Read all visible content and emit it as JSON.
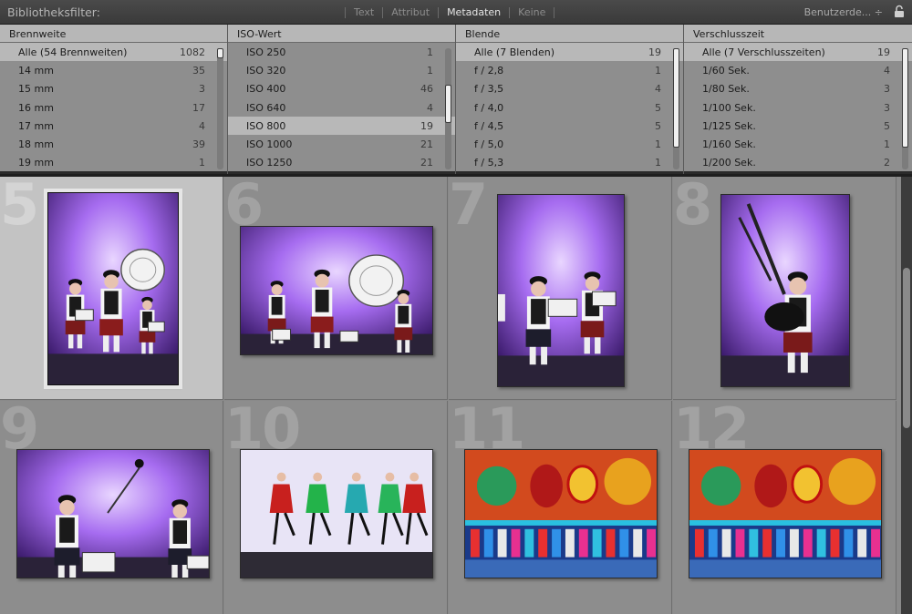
{
  "filterbar": {
    "title": "Bibliotheksfilter:",
    "modes": [
      {
        "label": "Text",
        "active": false
      },
      {
        "label": "Attribut",
        "active": false
      },
      {
        "label": "Metadaten",
        "active": true
      },
      {
        "label": "Keine",
        "active": false
      }
    ],
    "preset": "Benutzerde... ÷",
    "lock_icon": "lock-icon"
  },
  "columns": [
    {
      "header": "Brennweite",
      "rows": [
        {
          "label": "Alle (54 Brennweiten)",
          "count": "1082",
          "selected": true
        },
        {
          "label": "14 mm",
          "count": "35"
        },
        {
          "label": "15 mm",
          "count": "3"
        },
        {
          "label": "16 mm",
          "count": "17"
        },
        {
          "label": "17 mm",
          "count": "4"
        },
        {
          "label": "18 mm",
          "count": "39"
        },
        {
          "label": "19 mm",
          "count": "1"
        }
      ],
      "scroll_thumb": {
        "from": 0.0,
        "to": 0.08
      }
    },
    {
      "header": "ISO-Wert",
      "rows": [
        {
          "label": "ISO 250",
          "count": "1"
        },
        {
          "label": "ISO 320",
          "count": "1"
        },
        {
          "label": "ISO 400",
          "count": "46"
        },
        {
          "label": "ISO 640",
          "count": "4"
        },
        {
          "label": "ISO 800",
          "count": "19",
          "selected": true
        },
        {
          "label": "ISO 1000",
          "count": "21"
        },
        {
          "label": "ISO 1250",
          "count": "21"
        }
      ],
      "scroll_thumb": {
        "from": 0.3,
        "to": 0.62
      }
    },
    {
      "header": "Blende",
      "rows": [
        {
          "label": "Alle (7 Blenden)",
          "count": "19",
          "selected": true
        },
        {
          "label": "f / 2,8",
          "count": "1"
        },
        {
          "label": "f / 3,5",
          "count": "4"
        },
        {
          "label": "f / 4,0",
          "count": "5"
        },
        {
          "label": "f / 4,5",
          "count": "5"
        },
        {
          "label": "f / 5,0",
          "count": "1"
        },
        {
          "label": "f / 5,3",
          "count": "1"
        }
      ],
      "scroll_thumb": {
        "from": 0.0,
        "to": 0.82
      }
    },
    {
      "header": "Verschlusszeit",
      "rows": [
        {
          "label": "Alle (7 Verschlusszeiten)",
          "count": "19",
          "selected": true
        },
        {
          "label": "1/60 Sek.",
          "count": "4"
        },
        {
          "label": "1/80 Sek.",
          "count": "3"
        },
        {
          "label": "1/100 Sek.",
          "count": "3"
        },
        {
          "label": "1/125 Sek.",
          "count": "5"
        },
        {
          "label": "1/160 Sek.",
          "count": "1"
        },
        {
          "label": "1/200 Sek.",
          "count": "2"
        }
      ],
      "scroll_thumb": {
        "from": 0.0,
        "to": 0.82
      }
    }
  ],
  "grid": {
    "cells": [
      {
        "number": "5",
        "selected": true,
        "scene": "drummers-portrait"
      },
      {
        "number": "6",
        "selected": false,
        "scene": "drummers-landscape"
      },
      {
        "number": "7",
        "selected": false,
        "scene": "snare-drummers-portrait"
      },
      {
        "number": "8",
        "selected": false,
        "scene": "bagpiper-portrait"
      },
      {
        "number": "9",
        "selected": false,
        "scene": "drummer-sticks-landscape"
      },
      {
        "number": "10",
        "selected": false,
        "scene": "dancers-landscape"
      },
      {
        "number": "11",
        "selected": false,
        "scene": "fairground-ride-landscape"
      },
      {
        "number": "12",
        "selected": false,
        "scene": "fairground-ride-landscape"
      }
    ]
  },
  "colors": {
    "panel_bg": "#8e8e8e",
    "selected_row": "#b8b8b8",
    "grid_bg": "#8d8d8d",
    "selected_cell": "#c3c3c3"
  }
}
